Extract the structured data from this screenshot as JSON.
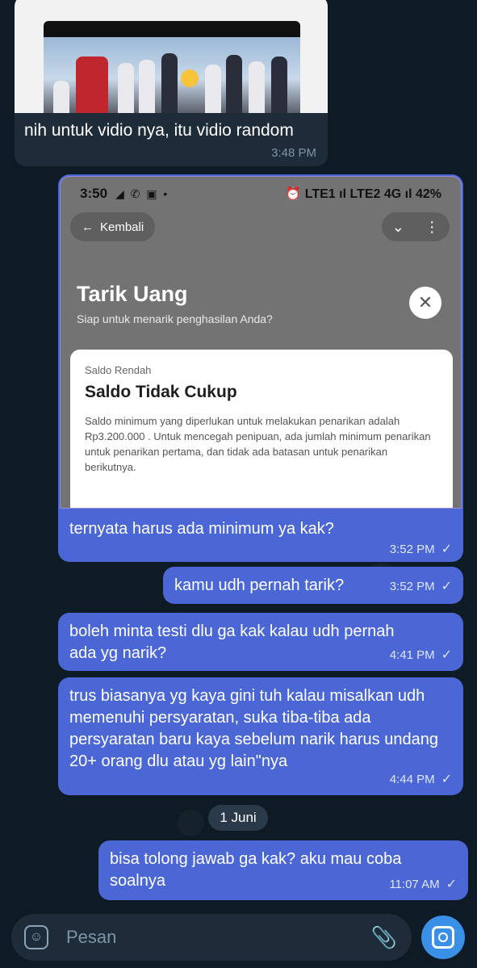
{
  "incoming": {
    "caption": "nih untuk vidio nya, itu vidio random",
    "time": "3:48 PM"
  },
  "screenshot_message": {
    "phone_status": {
      "time": "3:50",
      "icons": "◢ ✆ ▣ •",
      "right": "⏰ LTE1 ıl LTE2 4G ıl 42%"
    },
    "back_label": "Kembali",
    "title": "Tarik Uang",
    "subtitle": "Siap untuk menarik penghasilan Anda?",
    "card": {
      "label": "Saldo Rendah",
      "title": "Saldo Tidak Cukup",
      "body": "Saldo minimum yang diperlukan untuk melakukan penarikan adalah Rp3.200.000 . Untuk mencegah penipuan, ada jumlah minimum penarikan untuk penarikan pertama, dan tidak ada batasan untuk penarikan berikutnya."
    },
    "caption": "ternyata harus ada minimum ya kak?",
    "time": "3:52 PM"
  },
  "messages": [
    {
      "text": "kamu udh pernah tarik?",
      "time": "3:52 PM"
    },
    {
      "text": "boleh minta testi dlu ga kak kalau udh pernah ada yg narik?",
      "time": "4:41 PM"
    },
    {
      "text": "trus biasanya yg kaya gini tuh kalau misalkan udh memenuhi persyaratan, suka tiba-tiba ada persyaratan baru kaya sebelum narik harus undang 20+ orang dlu atau yg lain\"nya",
      "time": "4:44 PM"
    },
    {
      "text": "bisa tolong jawab ga kak? aku mau coba soalnya",
      "time": "11:07 AM"
    }
  ],
  "date_separator": "1 Juni",
  "composer": {
    "placeholder": "Pesan"
  },
  "colors": {
    "outgoing": "#4b67d6",
    "incoming": "#1e2c3a",
    "background": "#0f1b24",
    "accent": "#3a8fe6"
  }
}
